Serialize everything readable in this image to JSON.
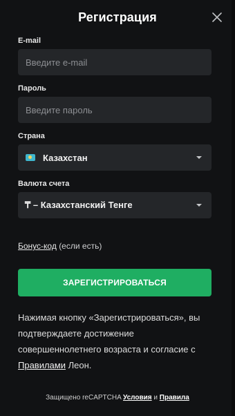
{
  "header": {
    "title": "Регистрация"
  },
  "form": {
    "email": {
      "label": "E-mail",
      "placeholder": "Введите e-mail",
      "value": ""
    },
    "password": {
      "label": "Пароль",
      "placeholder": "Введите пароль",
      "value": ""
    },
    "country": {
      "label": "Страна",
      "value": "Казахстан",
      "flag_icon": "kazakhstan-flag-icon"
    },
    "currency": {
      "label": "Валюта счета",
      "value": "₸ – Казахстанский Тенге"
    },
    "bonus": {
      "link": "Бонус-код",
      "note": "(если есть)"
    },
    "register_button": "ЗАРЕГИСТРИРОВАТЬСЯ"
  },
  "terms": {
    "line1": "Нажимая кнопку «Зарегистрироваться», вы",
    "line2": "подтверждаете достижение",
    "line3": "совершеннолетнего возраста и согласие с",
    "rules_link": "Правилами",
    "suffix": " Леон."
  },
  "recaptcha": {
    "prefix": "Защищено reCAPTCHA ",
    "terms_link": "Условия",
    "joiner": " и ",
    "privacy_link": "Правила"
  },
  "colors": {
    "background": "#111214",
    "input_bg": "#242629",
    "accent_green": "#1fae62"
  }
}
